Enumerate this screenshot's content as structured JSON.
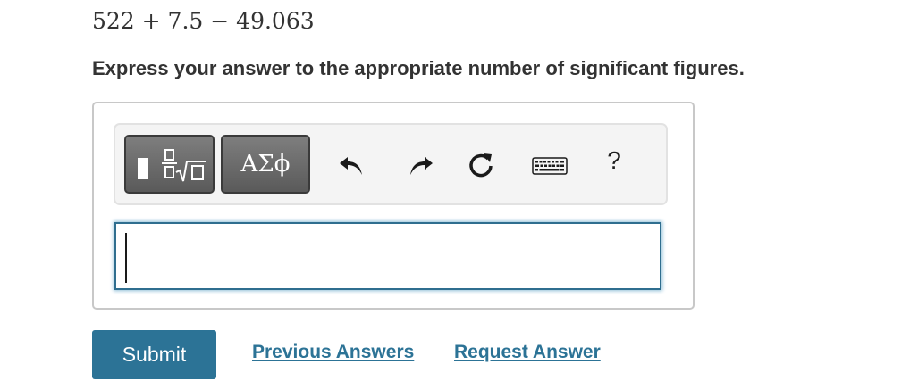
{
  "problem": {
    "expression": "522 + 7.5 − 49.063",
    "instruction": "Express your answer to the appropriate number of significant figures."
  },
  "toolbar": {
    "templates_icon": "templates-root-fraction-icon",
    "greek_label": "ΑΣϕ",
    "undo_icon": "undo-arrow-icon",
    "redo_icon": "redo-arrow-icon",
    "reset_icon": "reset-circular-arrow-icon",
    "keyboard_icon": "keyboard-icon",
    "help_label": "?"
  },
  "answer": {
    "value": ""
  },
  "actions": {
    "submit_label": "Submit",
    "previous_answers_label": "Previous Answers",
    "request_answer_label": "Request Answer"
  },
  "colors": {
    "accent": "#2c7396",
    "toolbar_button": "#6a6a6a",
    "input_border": "#2f6e8f"
  }
}
